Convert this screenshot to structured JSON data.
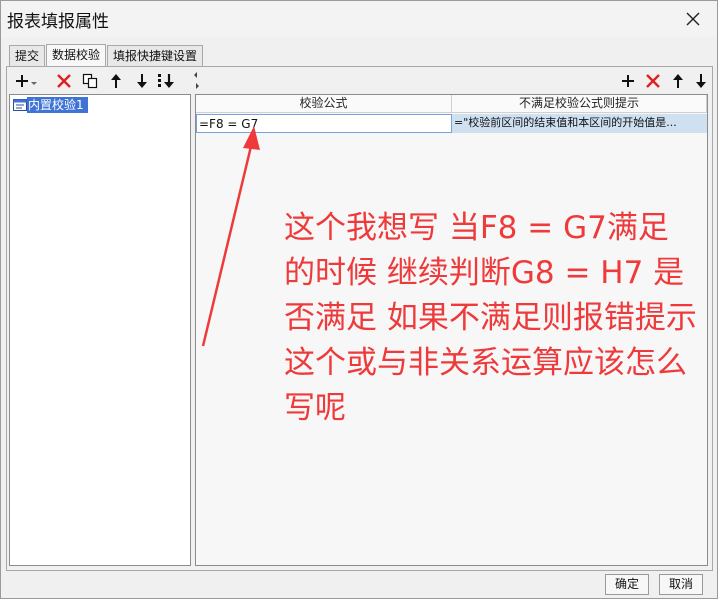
{
  "window": {
    "title": "报表填报属性"
  },
  "tabs": [
    {
      "label": "提交"
    },
    {
      "label": "数据校验"
    },
    {
      "label": "填报快捷键设置"
    }
  ],
  "left": {
    "items": [
      {
        "label": "内置校验1"
      }
    ]
  },
  "grid": {
    "columns": [
      "校验公式",
      "不满足校验公式则提示"
    ],
    "rows": [
      {
        "formula": "=F8 = G7",
        "message": "=\"校验前区间的结束值和本区间的开始值是..."
      }
    ]
  },
  "annotation": {
    "text": "这个我想写 当F8 = G7满足的时候 继续判断G8 = H7 是否满足 如果不满足则报错提示 这个或与非关系运算应该怎么写呢",
    "color": "#ee3a3a"
  },
  "footer": {
    "ok": "确定",
    "cancel": "取消"
  },
  "colors": {
    "selection": "#3f74d6",
    "delete": "#e02020"
  }
}
